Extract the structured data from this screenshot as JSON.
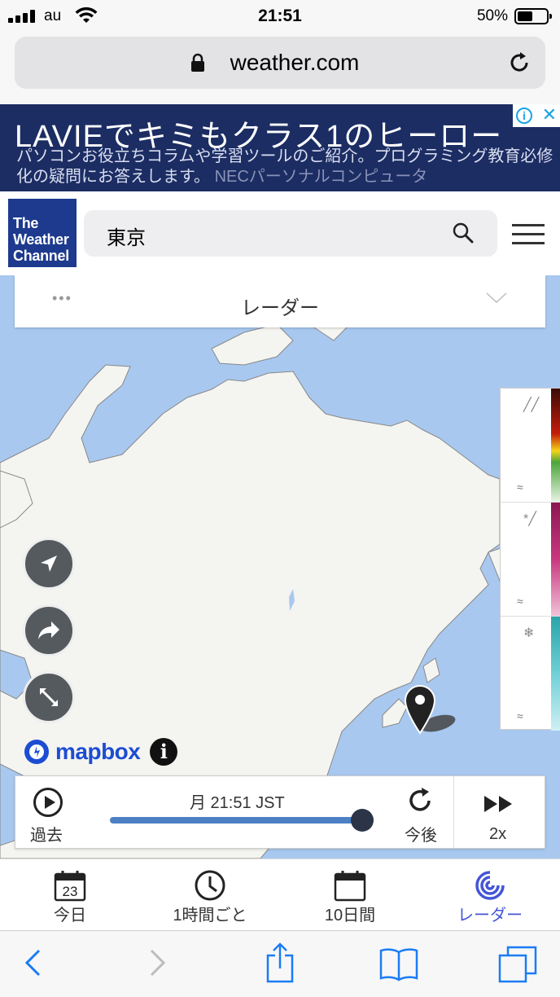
{
  "status": {
    "carrier": "au",
    "time": "21:51",
    "battery": "50%"
  },
  "browser": {
    "url": "weather.com"
  },
  "ad": {
    "headline": "LAVIEでキミもクラス1のヒーロー",
    "description": "パソコンお役立ちコラムや学習ツールのご紹介。プログラミング教育必修化の疑問にお答えします。",
    "advertiser": "NECパーソナルコンピュータ",
    "info_icon": "info-icon",
    "close_icon": "close-icon"
  },
  "header": {
    "logo_line1": "The",
    "logo_line2": "Weather",
    "logo_line3": "Channel",
    "search_value": "東京"
  },
  "map": {
    "layer_label": "レーダー",
    "attribution": "mapbox",
    "buttons": [
      "locate-icon",
      "share-icon",
      "expand-icon"
    ],
    "legend": [
      "rain",
      "mix",
      "snow"
    ]
  },
  "timeline": {
    "past_label": "過去",
    "timestamp": "月 21:51 JST",
    "future_label": "今後",
    "speed_label": "2x",
    "progress": 0.95
  },
  "tabs": [
    {
      "label": "今日",
      "icon_text": "23"
    },
    {
      "label": "1時間ごと"
    },
    {
      "label": "10日間"
    },
    {
      "label": "レーダー"
    }
  ],
  "colors": {
    "brand": "#1d3a8e",
    "active_tab": "#4455d6",
    "ad_bg": "#1c2d63",
    "ocean": "#a8c8ef",
    "safari_blue": "#1a7cf5"
  }
}
